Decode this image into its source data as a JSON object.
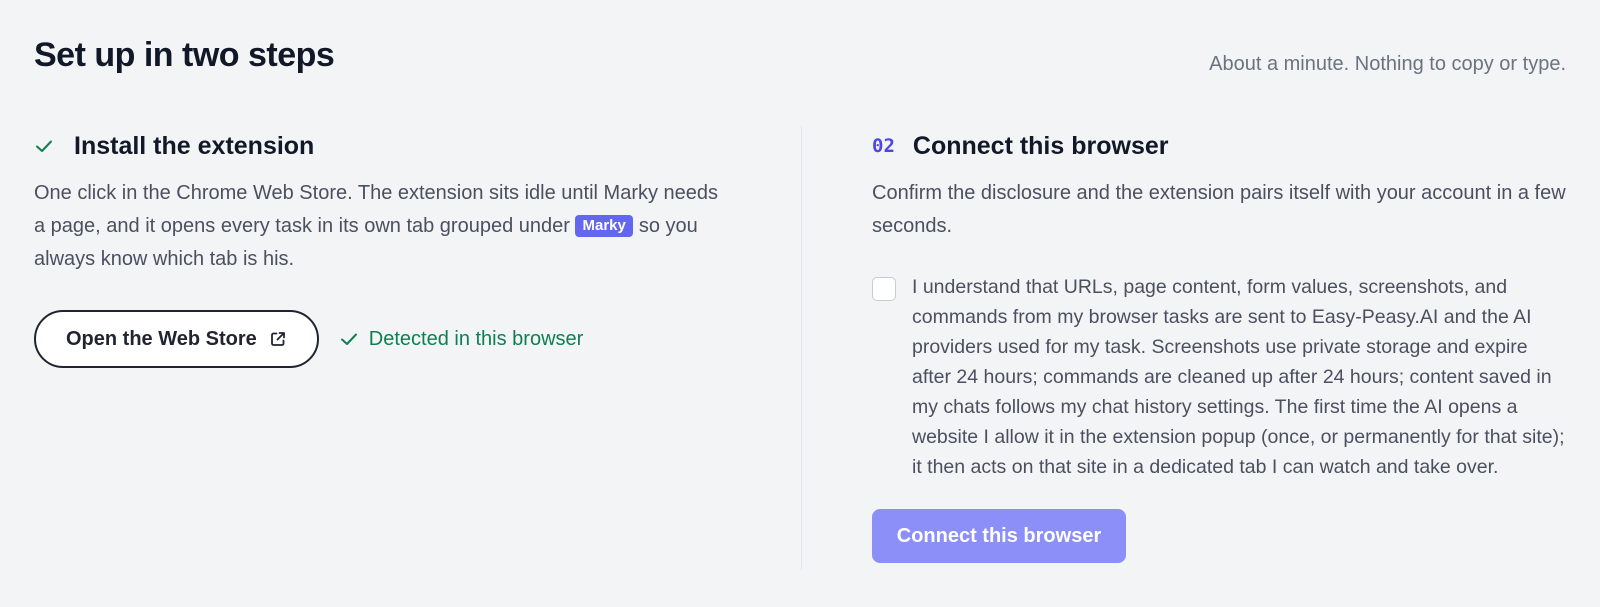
{
  "header": {
    "title": "Set up in two steps",
    "subtitle": "About a minute. Nothing to copy or type."
  },
  "step1": {
    "status_icon": "check-icon",
    "title": "Install the extension",
    "body_before_badge": "One click in the Chrome Web Store. The extension sits idle until Marky needs a page, and it opens every task in its own tab grouped under",
    "badge": "Marky",
    "body_after_badge": "so you always know which tab is his.",
    "button_label": "Open the Web Store",
    "button_icon": "external-link-icon",
    "status_text": "Detected in this browser",
    "status_color": "#0f7f4f"
  },
  "step2": {
    "number": "02",
    "title": "Connect this browser",
    "body": "Confirm the disclosure and the extension pairs itself with your account in a few seconds.",
    "consent_checked": false,
    "consent_text": "I understand that URLs, page content, form values, screenshots, and commands from my browser tasks are sent to Easy-Peasy.AI and the AI providers used for my task. Screenshots use private storage and expire after 24 hours; commands are cleaned up after 24 hours; content saved in my chats follows my chat history settings. The first time the AI opens a website I allow it in the extension popup (once, or permanently for that site); it then acts on that site in a dedicated tab I can watch and take over.",
    "button_label": "Connect this browser"
  },
  "colors": {
    "accent": "#6366f1",
    "button_disabled": "#8b8ff7",
    "success": "#0f7f4f",
    "background": "#f3f4f6"
  }
}
